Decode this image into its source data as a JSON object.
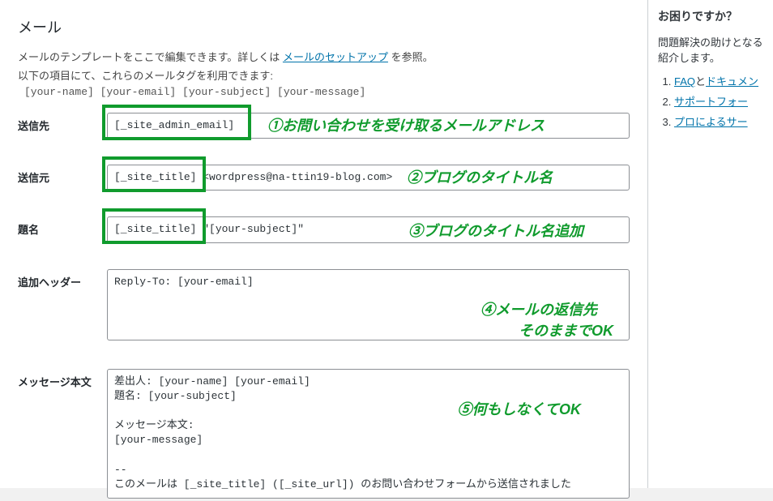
{
  "section_title": "メール",
  "intro_prefix": "メールのテンプレートをここで編集できます。詳しくは",
  "intro_link": "メールのセットアップ",
  "intro_suffix": "を参照。",
  "tagline_intro": "以下の項目にて、これらのメールタグを利用できます:",
  "tagline_tags": "[your-name] [your-email] [your-subject] [your-message]",
  "fields": {
    "to": {
      "label": "送信先",
      "value": "[_site_admin_email]"
    },
    "from": {
      "label": "送信元",
      "value": "[_site_title] <wordpress@na-ttin19-blog.com>"
    },
    "subject": {
      "label": "題名",
      "value": "[_site_title] \"[your-subject]\""
    },
    "headers": {
      "label": "追加ヘッダー",
      "value": "Reply-To: [your-email]"
    },
    "body": {
      "label": "メッセージ本文",
      "value": "差出人: [your-name] [your-email]\n題名: [your-subject]\n\nメッセージ本文:\n[your-message]\n\n-- \nこのメールは [_site_title] ([_site_url]) のお問い合わせフォームから送信されました"
    }
  },
  "anno": {
    "n1": "①",
    "t1": "お問い合わせを受け取るメールアドレス",
    "n2": "②",
    "t2": "ブログのタイトル名",
    "n3": "③",
    "t3": "ブログのタイトル名追加",
    "n4": "④",
    "t4a": "メールの返信先",
    "t4b": "そのままでOK",
    "n5": "⑤",
    "t5": "何もしなくてOK"
  },
  "side": {
    "title": "お困りですか？",
    "intro": "問題解決の助けとなる紹介します。",
    "items": [
      {
        "prefix": "FAQ",
        "middle": "と",
        "suffix": "ドキュメン"
      },
      {
        "link": "サポートフォー"
      },
      {
        "link": "プロによるサー"
      }
    ]
  }
}
